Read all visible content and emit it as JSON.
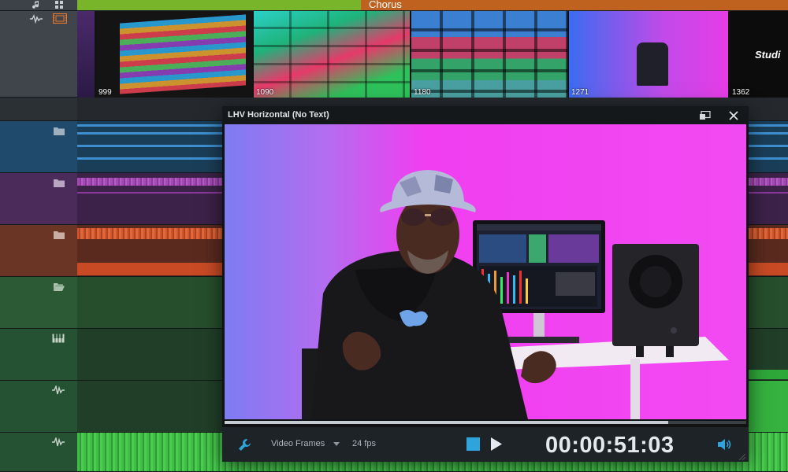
{
  "arrangement": {
    "section_label": "Chorus"
  },
  "video_track": {
    "thumbnails": [
      {
        "frame": "",
        "label": ""
      },
      {
        "frame": "999",
        "label": ""
      },
      {
        "frame": "1090",
        "label": ""
      },
      {
        "frame": "1180",
        "label": ""
      },
      {
        "frame": "1271",
        "label": ""
      },
      {
        "frame": "1362",
        "label": "Studi"
      }
    ]
  },
  "tracks": [
    {
      "icon": "folder-icon",
      "color": "#1f4a6b"
    },
    {
      "icon": "folder-icon",
      "color": "#4a2b5a"
    },
    {
      "icon": "folder-icon",
      "color": "#6b3526"
    },
    {
      "icon": "folder-open-icon",
      "color": "#2c5a34"
    },
    {
      "icon": "piano-icon",
      "color": "#245232"
    },
    {
      "icon": "audio-wave-icon",
      "color": "#245232"
    },
    {
      "icon": "audio-wave-icon",
      "color": "#245232"
    }
  ],
  "video_window": {
    "title": "LHV Horizontal (No Text)",
    "playback_progress_pct": 85,
    "controls": {
      "mode_label": "Video Frames",
      "fps_label": "24 fps",
      "timecode": "00:00:51:03"
    }
  },
  "colors": {
    "chorus_green": "#78b52a",
    "chorus_orange": "#c0621f",
    "video_pink": "#f03cf0",
    "accent_blue": "#29a3dc"
  }
}
